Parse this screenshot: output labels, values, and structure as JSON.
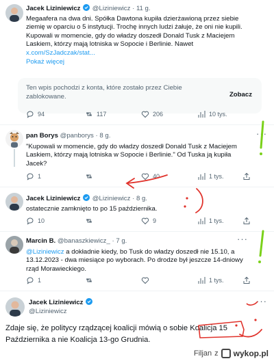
{
  "tweets": [
    {
      "name": "Jacek Liziniewicz",
      "handle": "@Liziniewicz",
      "time": "11 g.",
      "lines": [
        "Megaafera na dwa dni. Spółka Dawtona kupiła dzierżawioną przez siebie",
        "ziemię w oparciu o 5 instytucji. Trochę innych ludzi żałuje, że oni nie kupili.",
        "Kupowali w momencie, gdy do władzy doszedł Donald Tusk z Maciejem",
        "Laskiem, którzy mają lotniska w Sopocie i Berlinie. Nawet"
      ],
      "link": "x.com/SzJadczak/stat...",
      "show_more": "Pokaż więcej",
      "blocked_line1": "Ten wpis pochodzi z konta, które zostało przez Ciebie",
      "blocked_line2": "zablokowane.",
      "blocked_action": "Zobacz",
      "stats": {
        "replies": "94",
        "reposts": "117",
        "likes": "206",
        "views": "10 tys."
      }
    },
    {
      "name": "pan Borys",
      "handle": "@panborys",
      "time": "8 g.",
      "lines": [
        "\"Kupowali w momencie, gdy do władzy doszedł Donald Tusk z Maciejem",
        "Laskiem, którzy mają lotniska w Sopocie i Berlinie.\" Od Tuska ją kupiła",
        "Jacek?"
      ],
      "stats": {
        "replies": "1",
        "reposts": "",
        "likes": "40",
        "views": "1 tys."
      }
    },
    {
      "name": "Jacek Liziniewicz",
      "handle": "@Liziniewicz",
      "time": "8 g.",
      "lines": [
        "ostatecznie zamknięto to po 15 października."
      ],
      "stats": {
        "replies": "10",
        "reposts": "",
        "likes": "9",
        "views": "1 tys."
      }
    },
    {
      "name": "Marcin B.",
      "handle": "@banaszkiewicz_",
      "time": "7 g.",
      "mention": "@Liziniewicz",
      "lines": [
        " a dokładnie kiedy, bo Tusk do władzy doszedł nie 15.10, a",
        "13.12.2023 - dwa miesiące po wyborach. Po drodze był jeszcze 14-dniowy",
        "rząd Morawieckiego."
      ],
      "stats": {
        "replies": "1",
        "reposts": "",
        "likes": "",
        "views": "1 tys."
      }
    },
    {
      "name": "Jacek Liziniewicz",
      "handle": "@Liziniewicz",
      "big_lines": [
        "Zdaje się, że politycy rządzącej koalicji mówią o sobie Koalicja 15",
        "Października a nie Koalicja 13-go Grudnia."
      ]
    }
  ],
  "footer": {
    "author": "Filjan",
    "z": "z",
    "site": "wykop.pl"
  },
  "colors": {
    "accent": "#1d9bf0",
    "muted": "#536471",
    "ink_red": "#e0322b",
    "ink_green": "#7ad11a"
  }
}
